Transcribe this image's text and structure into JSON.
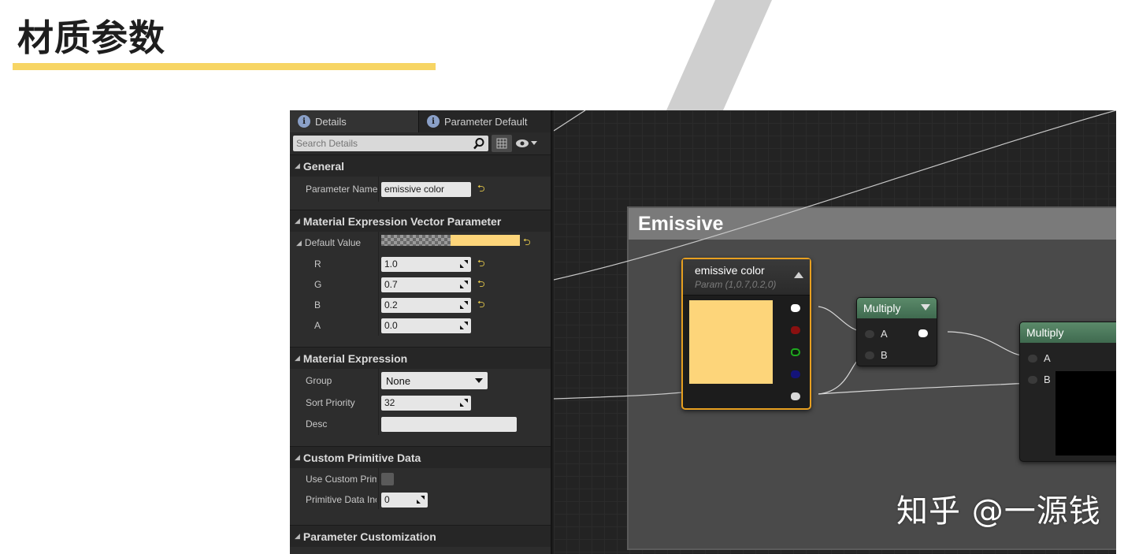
{
  "slide": {
    "title": "材质参数",
    "accent_color": "#f7d564"
  },
  "details_panel": {
    "tabs": [
      {
        "label": "Details",
        "icon": "info-icon"
      },
      {
        "label": "Parameter Default",
        "icon": "info-icon"
      }
    ],
    "search": {
      "placeholder": "Search Details"
    },
    "sections": {
      "general": {
        "title": "General",
        "parameter_name_label": "Parameter Name",
        "parameter_name_value": "emissive color"
      },
      "vector_param": {
        "title": "Material Expression Vector Parameter",
        "default_value_label": "Default Value",
        "default_color": "#fdd57a",
        "r_label": "R",
        "r_value": "1.0",
        "g_label": "G",
        "g_value": "0.7",
        "b_label": "B",
        "b_value": "0.2",
        "a_label": "A",
        "a_value": "0.0"
      },
      "material_expression": {
        "title": "Material Expression",
        "group_label": "Group",
        "group_value": "None",
        "sort_priority_label": "Sort Priority",
        "sort_priority_value": "32",
        "desc_label": "Desc",
        "desc_value": ""
      },
      "custom_primitive": {
        "title": "Custom Primitive Data",
        "use_custom_label": "Use Custom Prim",
        "use_custom_checked": false,
        "primitive_index_label": "Primitive Data Inc",
        "primitive_index_value": "0"
      },
      "parameter_customization": {
        "title": "Parameter Customization"
      }
    }
  },
  "graph": {
    "comment_title": "Emissive",
    "param_node": {
      "title": "emissive color",
      "subtitle": "Param (1,0.7,0.2,0)",
      "preview_color": "#fdd57a",
      "border_color": "#e8a020"
    },
    "multiply_node_1": {
      "title": "Multiply",
      "pin_a": "A",
      "pin_b": "B"
    },
    "multiply_node_2": {
      "title": "Multiply",
      "pin_a": "A",
      "pin_b": "B"
    }
  },
  "watermark": "知乎 @一源钱"
}
